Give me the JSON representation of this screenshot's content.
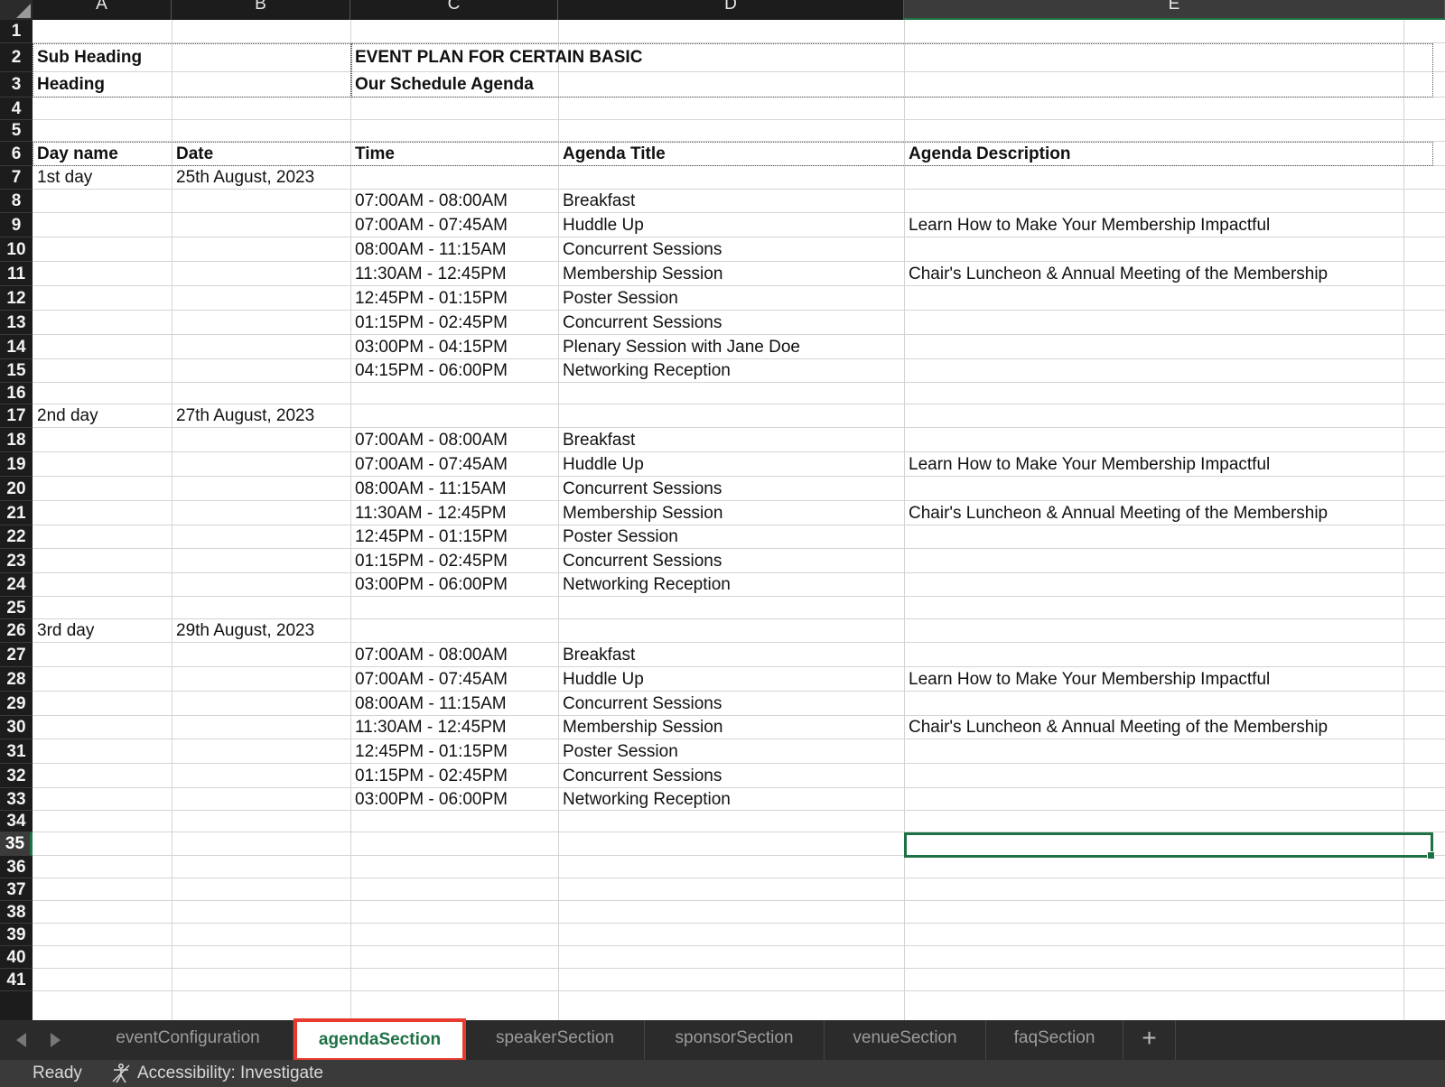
{
  "columns": [
    "A",
    "B",
    "C",
    "D",
    "E"
  ],
  "active_column": "E",
  "active_row": 35,
  "rows": [
    {
      "n": 1,
      "cells": [
        "",
        "",
        "",
        "",
        ""
      ]
    },
    {
      "n": 2,
      "cells": [
        "Sub Heading",
        "",
        "EVENT PLAN FOR CERTAIN BASIC",
        "",
        ""
      ]
    },
    {
      "n": 3,
      "cells": [
        "Heading",
        "",
        "Our Schedule Agenda",
        "",
        ""
      ]
    },
    {
      "n": 4,
      "cells": [
        "",
        "",
        "",
        "",
        ""
      ]
    },
    {
      "n": 5,
      "cells": [
        "",
        "",
        "",
        "",
        ""
      ]
    },
    {
      "n": 6,
      "cells": [
        "Day name",
        "Date",
        "Time",
        "Agenda Title",
        "Agenda Description"
      ]
    },
    {
      "n": 7,
      "cells": [
        "1st day",
        "25th August, 2023",
        "",
        "",
        ""
      ]
    },
    {
      "n": 8,
      "cells": [
        "",
        "",
        "07:00AM - 08:00AM",
        "Breakfast",
        ""
      ]
    },
    {
      "n": 9,
      "cells": [
        "",
        "",
        "07:00AM - 07:45AM",
        "Huddle Up",
        "Learn How to Make Your Membership Impactful"
      ]
    },
    {
      "n": 10,
      "cells": [
        "",
        "",
        "08:00AM - 11:15AM",
        "Concurrent Sessions",
        ""
      ]
    },
    {
      "n": 11,
      "cells": [
        "",
        "",
        "11:30AM - 12:45PM",
        "Membership Session",
        "Chair's Luncheon & Annual Meeting of the Membership"
      ]
    },
    {
      "n": 12,
      "cells": [
        "",
        "",
        "12:45PM - 01:15PM",
        "Poster Session",
        ""
      ]
    },
    {
      "n": 13,
      "cells": [
        "",
        "",
        "01:15PM - 02:45PM",
        "Concurrent Sessions",
        ""
      ]
    },
    {
      "n": 14,
      "cells": [
        "",
        "",
        "03:00PM - 04:15PM",
        "Plenary Session with Jane Doe",
        ""
      ]
    },
    {
      "n": 15,
      "cells": [
        "",
        "",
        "04:15PM - 06:00PM",
        "Networking Reception",
        ""
      ]
    },
    {
      "n": 16,
      "cells": [
        "",
        "",
        "",
        "",
        ""
      ]
    },
    {
      "n": 17,
      "cells": [
        "2nd day",
        "27th August, 2023",
        "",
        "",
        ""
      ]
    },
    {
      "n": 18,
      "cells": [
        "",
        "",
        "07:00AM - 08:00AM",
        "Breakfast",
        ""
      ]
    },
    {
      "n": 19,
      "cells": [
        "",
        "",
        "07:00AM - 07:45AM",
        "Huddle Up",
        "Learn How to Make Your Membership Impactful"
      ]
    },
    {
      "n": 20,
      "cells": [
        "",
        "",
        "08:00AM - 11:15AM",
        "Concurrent Sessions",
        ""
      ]
    },
    {
      "n": 21,
      "cells": [
        "",
        "",
        "11:30AM - 12:45PM",
        "Membership Session",
        "Chair's Luncheon & Annual Meeting of the Membership"
      ]
    },
    {
      "n": 22,
      "cells": [
        "",
        "",
        "12:45PM - 01:15PM",
        "Poster Session",
        ""
      ]
    },
    {
      "n": 23,
      "cells": [
        "",
        "",
        "01:15PM - 02:45PM",
        "Concurrent Sessions",
        ""
      ]
    },
    {
      "n": 24,
      "cells": [
        "",
        "",
        "03:00PM - 06:00PM",
        "Networking Reception",
        ""
      ]
    },
    {
      "n": 25,
      "cells": [
        "",
        "",
        "",
        "",
        ""
      ]
    },
    {
      "n": 26,
      "cells": [
        "3rd day",
        "29th August, 2023",
        "",
        "",
        ""
      ]
    },
    {
      "n": 27,
      "cells": [
        "",
        "",
        "07:00AM - 08:00AM",
        "Breakfast",
        ""
      ]
    },
    {
      "n": 28,
      "cells": [
        "",
        "",
        "07:00AM - 07:45AM",
        "Huddle Up",
        "Learn How to Make Your Membership Impactful"
      ]
    },
    {
      "n": 29,
      "cells": [
        "",
        "",
        "08:00AM - 11:15AM",
        "Concurrent Sessions",
        ""
      ]
    },
    {
      "n": 30,
      "cells": [
        "",
        "",
        "11:30AM - 12:45PM",
        "Membership Session",
        "Chair's Luncheon & Annual Meeting of the Membership"
      ]
    },
    {
      "n": 31,
      "cells": [
        "",
        "",
        "12:45PM - 01:15PM",
        "Poster Session",
        ""
      ]
    },
    {
      "n": 32,
      "cells": [
        "",
        "",
        "01:15PM - 02:45PM",
        "Concurrent Sessions",
        ""
      ]
    },
    {
      "n": 33,
      "cells": [
        "",
        "",
        "03:00PM - 06:00PM",
        "Networking Reception",
        ""
      ]
    },
    {
      "n": 34,
      "cells": [
        "",
        "",
        "",
        "",
        ""
      ]
    },
    {
      "n": 35,
      "cells": [
        "",
        "",
        "",
        "",
        ""
      ]
    },
    {
      "n": 36,
      "cells": [
        "",
        "",
        "",
        "",
        ""
      ]
    },
    {
      "n": 37,
      "cells": [
        "",
        "",
        "",
        "",
        ""
      ]
    },
    {
      "n": 38,
      "cells": [
        "",
        "",
        "",
        "",
        ""
      ]
    },
    {
      "n": 39,
      "cells": [
        "",
        "",
        "",
        "",
        ""
      ]
    },
    {
      "n": 40,
      "cells": [
        "",
        "",
        "",
        "",
        ""
      ]
    },
    {
      "n": 41,
      "cells": [
        "",
        "",
        "",
        "",
        ""
      ]
    }
  ],
  "bold_rows": [
    2,
    3,
    6
  ],
  "sheet_tabs": [
    "eventConfiguration",
    "agendaSection",
    "speakerSection",
    "sponsorSection",
    "venueSection",
    "faqSection"
  ],
  "active_tab": "agendaSection",
  "add_sheet_label": "+",
  "status": {
    "ready": "Ready",
    "accessibility": "Accessibility: Investigate"
  },
  "colors": {
    "accent_green": "#1e7145",
    "highlight_red": "#e63b2e",
    "header_bg": "#1c1c1c"
  },
  "icons": [
    "accessibility-icon",
    "prev-sheet-icon",
    "next-sheet-icon",
    "add-sheet-icon"
  ]
}
